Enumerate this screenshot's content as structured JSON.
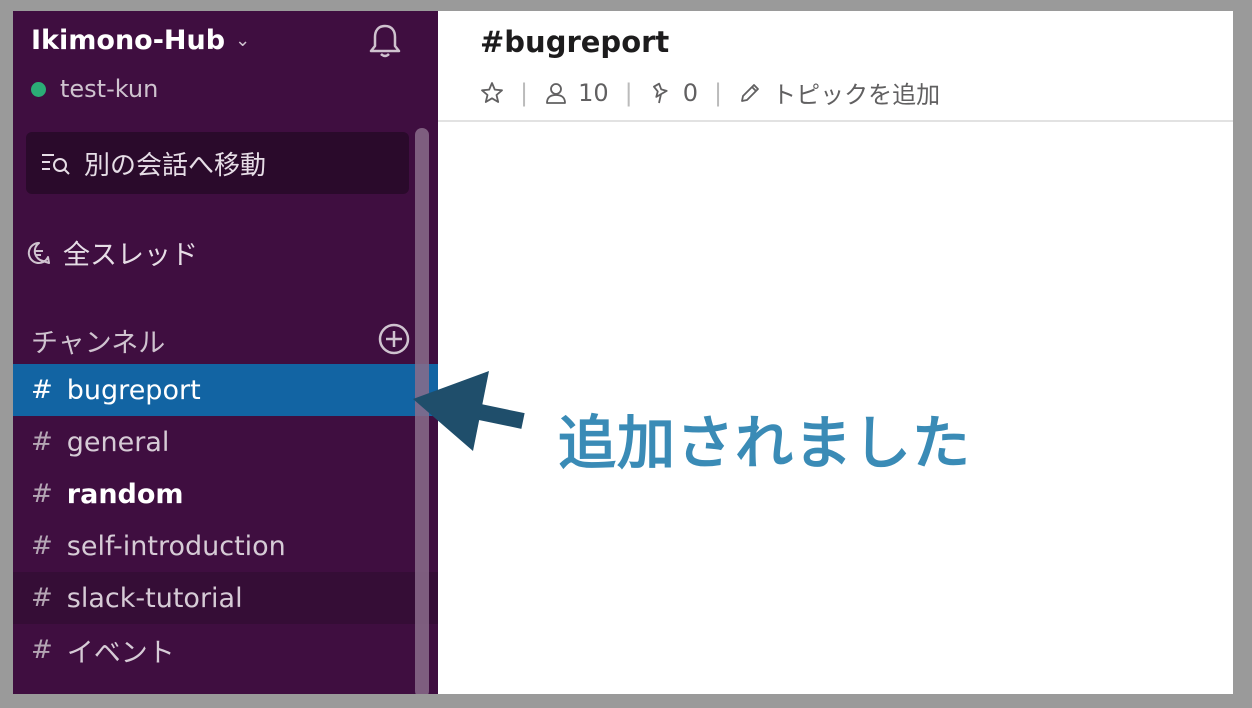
{
  "workspace": {
    "name": "Ikimono-Hub",
    "user": "test-kun"
  },
  "sidebar": {
    "jump_label": "別の会話へ移動",
    "threads_label": "全スレッド",
    "channels_header": "チャンネル",
    "channels": [
      {
        "hash": "#",
        "name": "bugreport",
        "state": "active"
      },
      {
        "hash": "#",
        "name": "general",
        "state": "normal"
      },
      {
        "hash": "#",
        "name": "random",
        "state": "unread"
      },
      {
        "hash": "#",
        "name": "self-introduction",
        "state": "normal"
      },
      {
        "hash": "#",
        "name": "slack-tutorial",
        "state": "hover"
      },
      {
        "hash": "#",
        "name": "イベント",
        "state": "normal"
      }
    ]
  },
  "channel_header": {
    "title": "#bugreport",
    "members": "10",
    "pins": "0",
    "topic_label": "トピックを追加",
    "separator": "|"
  },
  "annotation": {
    "text": "追加されました"
  },
  "colors": {
    "sidebar_bg": "#3f0e40",
    "active_channel": "#1264a3",
    "status_online": "#2bac76",
    "annotation": "#3a8bb6",
    "arrow": "#1f4e6b"
  }
}
